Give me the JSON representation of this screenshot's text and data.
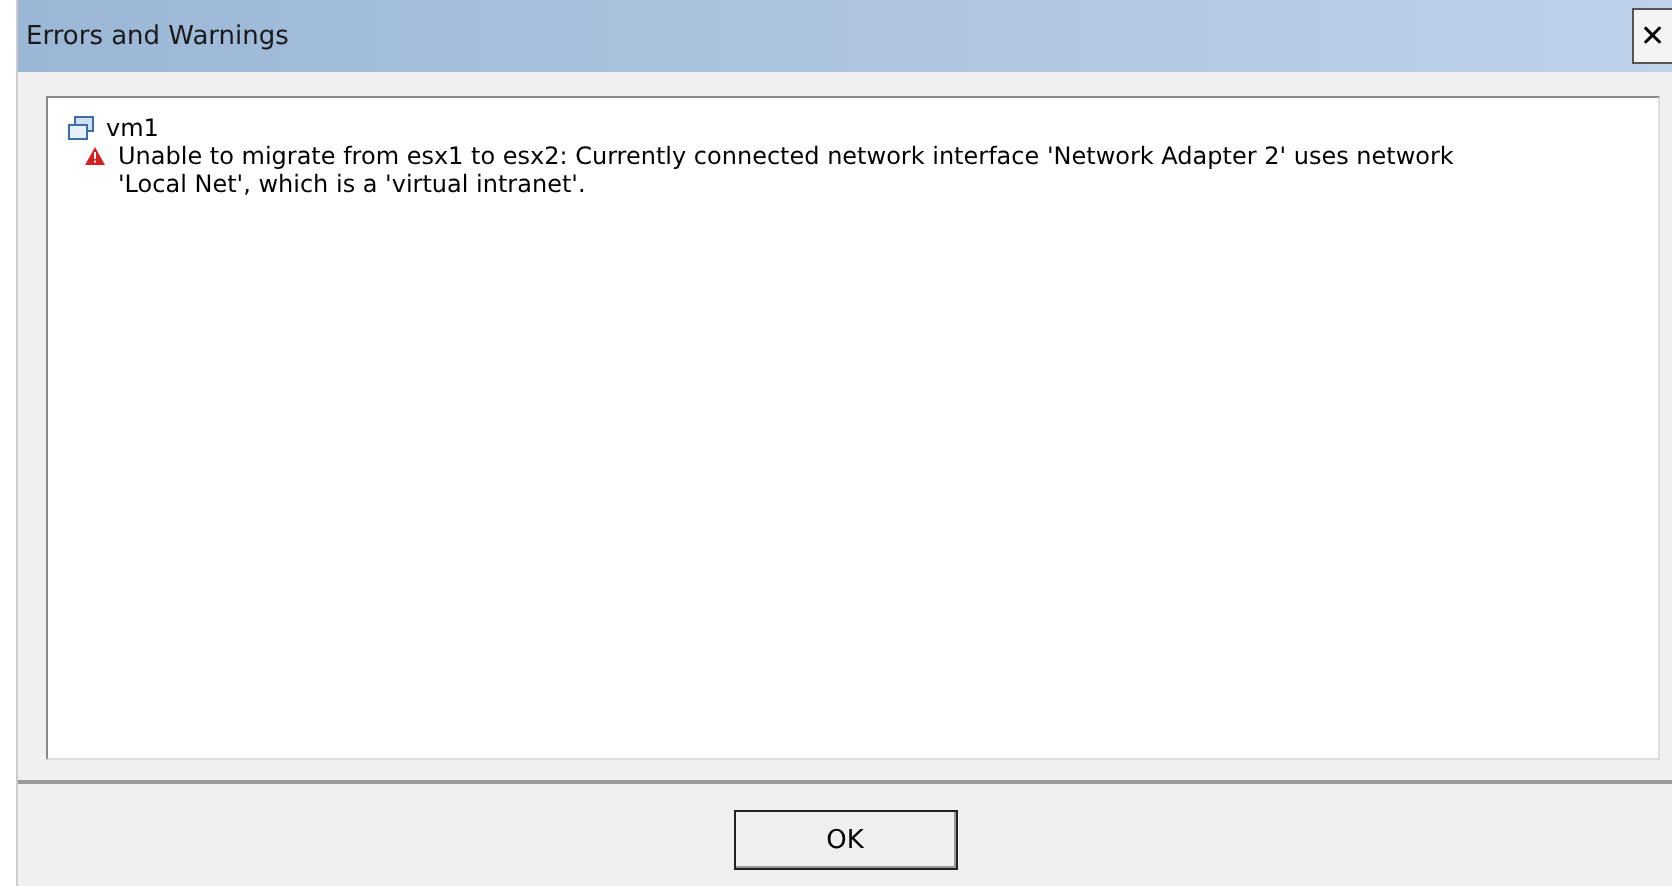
{
  "window": {
    "title": "Errors and Warnings",
    "close": "✕"
  },
  "messages": [
    {
      "object": "vm1",
      "items": [
        {
          "kind": "error",
          "text": "Unable to migrate from esx1 to esx2: Currently connected network interface 'Network Adapter 2' uses network 'Local Net', which is a 'virtual intranet'."
        }
      ]
    }
  ],
  "buttons": [
    "OK"
  ]
}
